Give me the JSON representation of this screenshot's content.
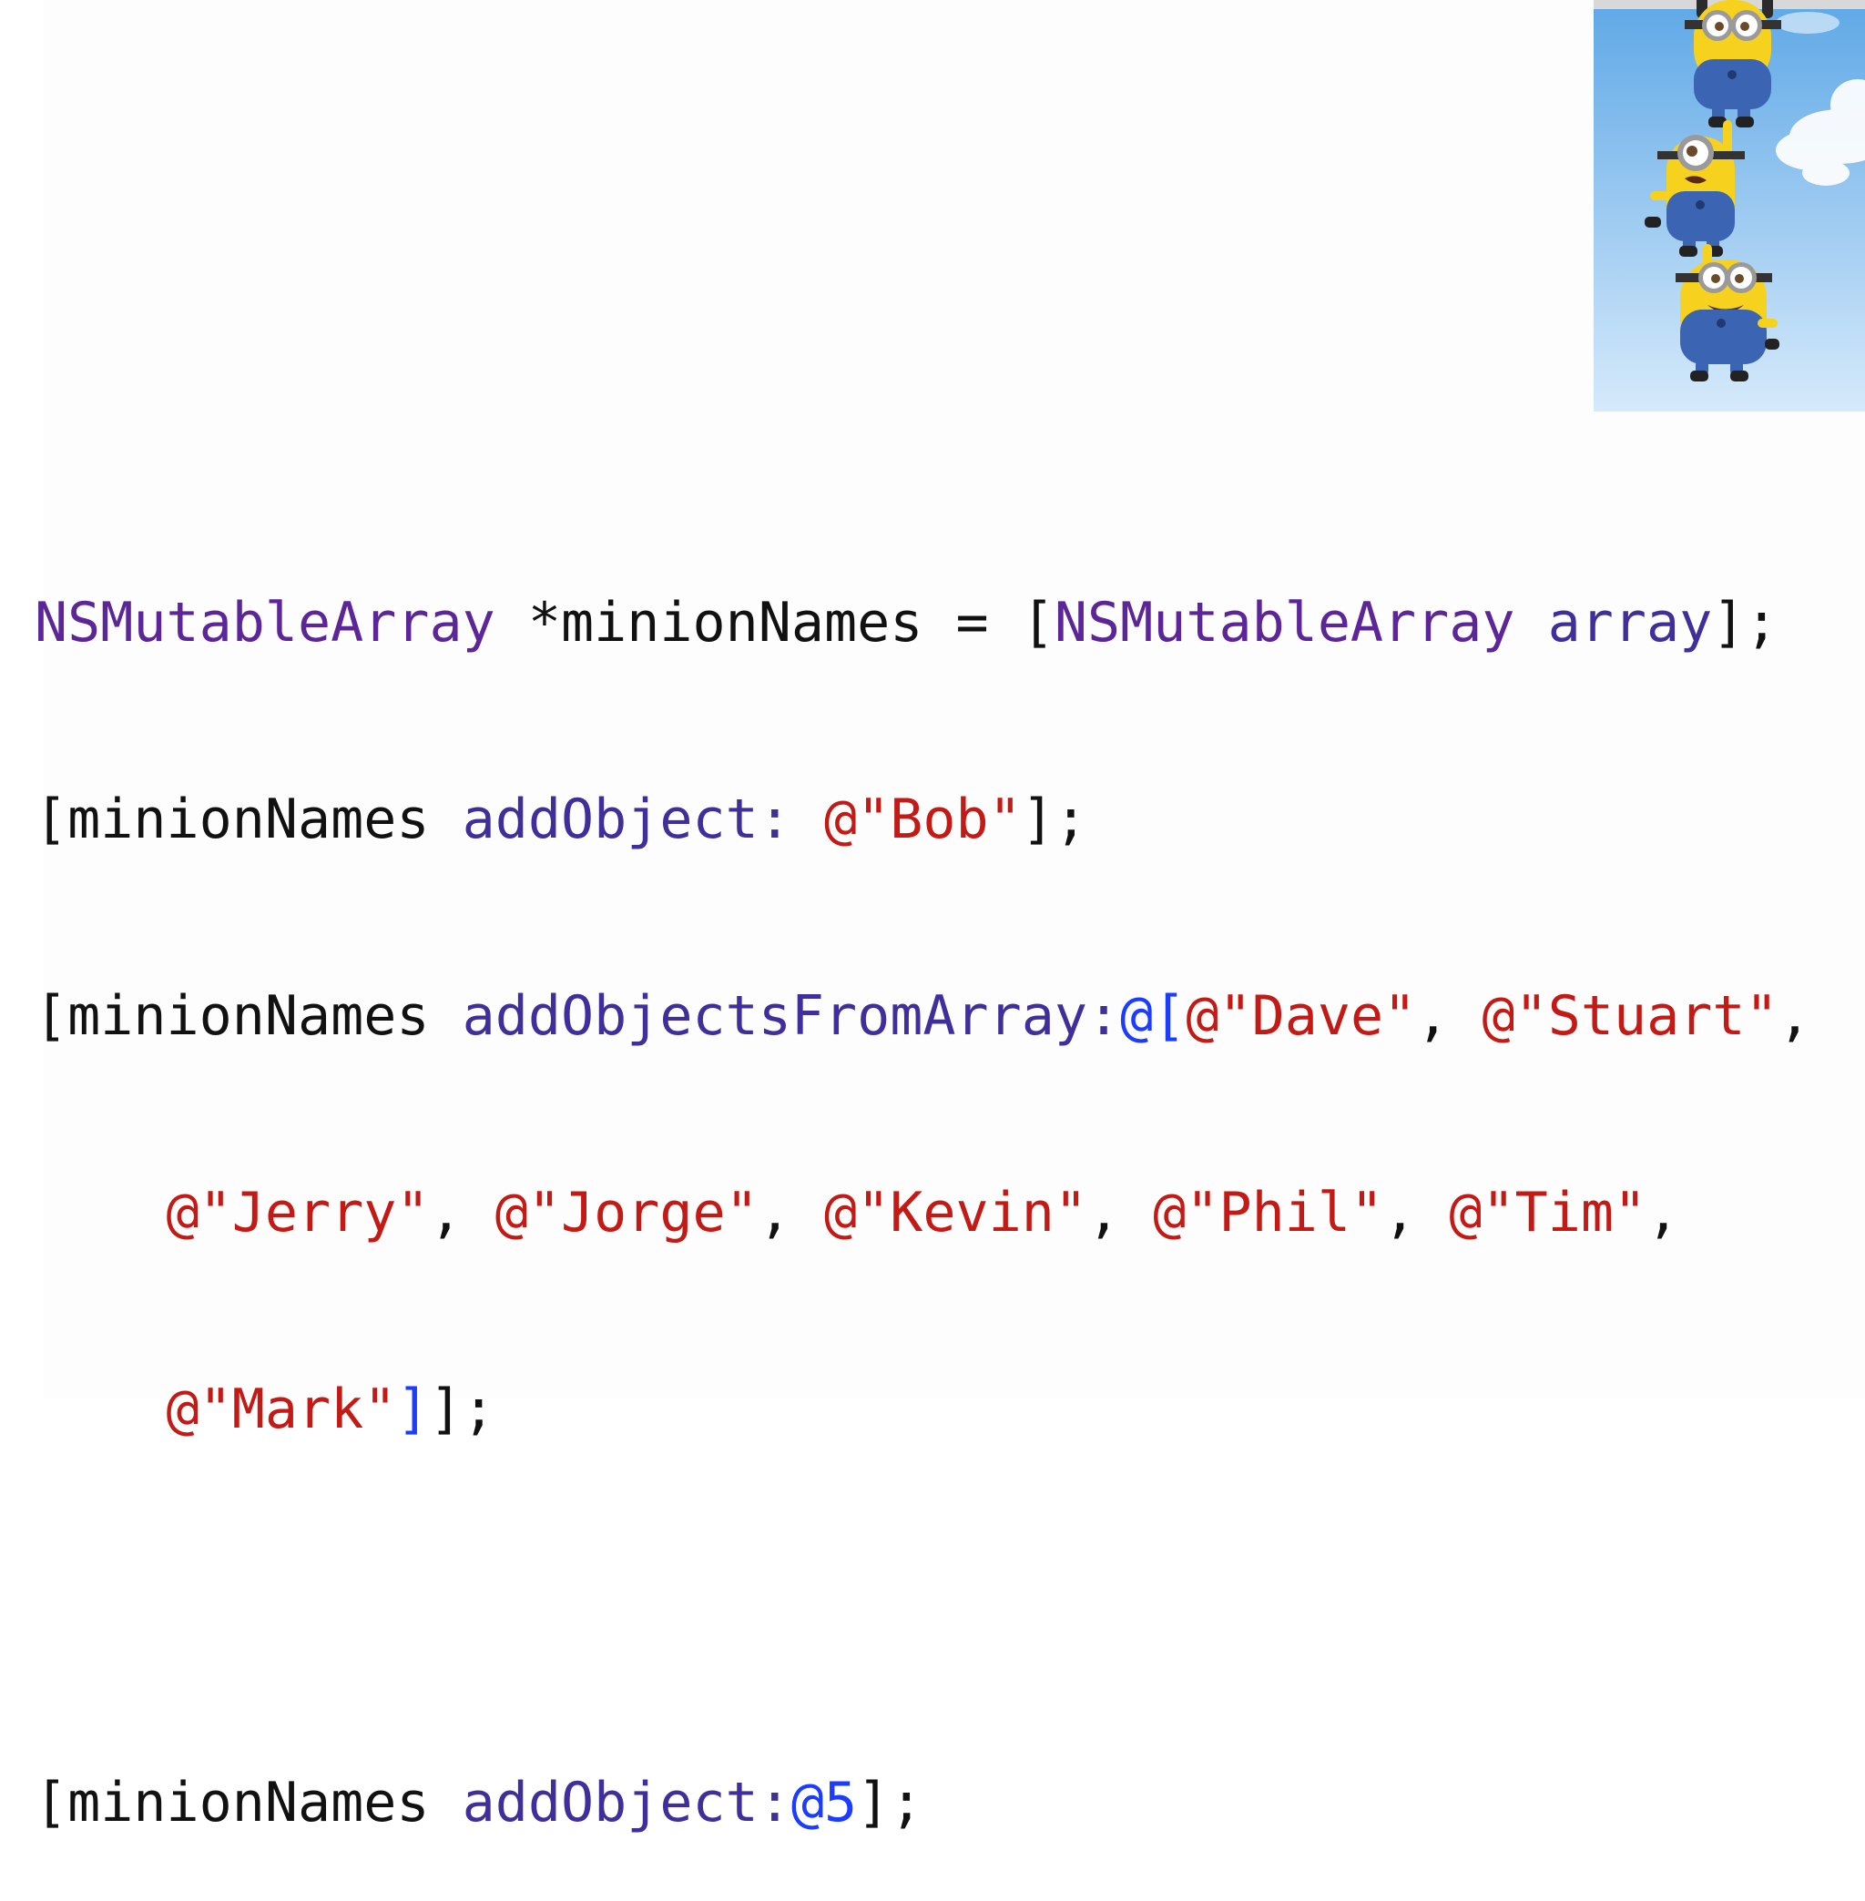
{
  "colors": {
    "class_name": "#5c2699",
    "method_name": "#3f2f9a",
    "string_literal": "#c41a16",
    "literal_marker": "#1c3cff",
    "text": "#111111",
    "sky_top": "#6fb3ea",
    "sky_bottom": "#d9ecfb",
    "minion_yellow": "#f6d21e",
    "minion_blue": "#3b65b3"
  },
  "illustration": {
    "icon": "minions-hanging-image"
  },
  "code": {
    "line1": {
      "class1": "NSMutableArray",
      "var_decl": " *minionNames = [",
      "class2": "NSMutableArray",
      "method": " array",
      "end": "];"
    },
    "line2": {
      "receiver": "[minionNames ",
      "method": "addObject:",
      "space": " ",
      "string": "@\"Bob\"",
      "end": "];"
    },
    "line3": {
      "receiver": "[minionNames ",
      "method": "addObjectsFromArray:",
      "array_open": "@[",
      "s1": "@\"Dave\"",
      "c1": ", ",
      "s2": "@\"Stuart\"",
      "c2": ","
    },
    "line4": {
      "indent": "    ",
      "s1": "@\"Jerry\"",
      "c1": ", ",
      "s2": "@\"Jorge\"",
      "c2": ", ",
      "s3": "@\"Kevin\"",
      "c3": ", ",
      "s4": "@\"Phil\"",
      "c4": ", ",
      "s5": "@\"Tim\"",
      "c5": ","
    },
    "line5": {
      "indent": "    ",
      "s1": "@\"Mark\"",
      "array_close": "]",
      "end": "];"
    },
    "line6": {
      "receiver": "[minionNames ",
      "method": "addObject:",
      "number": "@5",
      "end": "];"
    }
  }
}
